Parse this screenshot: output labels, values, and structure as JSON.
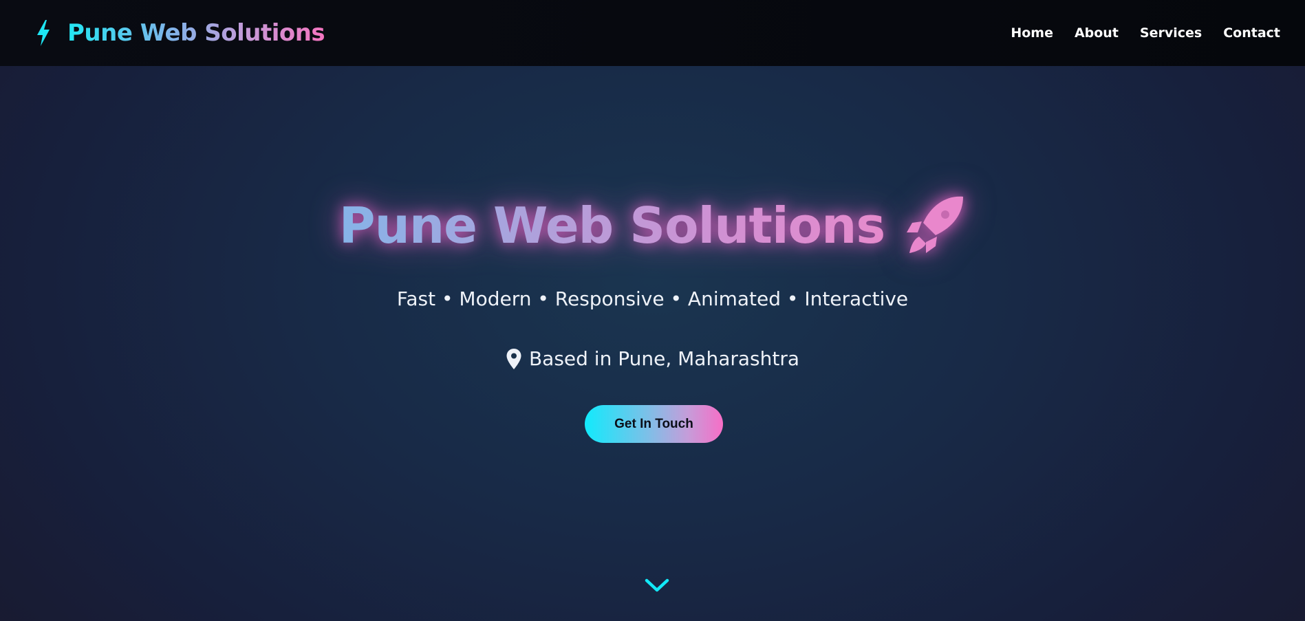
{
  "navbar": {
    "brand_icon": "bolt-icon",
    "brand_name": "Pune Web Solutions",
    "links": [
      "Home",
      "About",
      "Services",
      "Contact"
    ]
  },
  "hero": {
    "title": "Pune Web Solutions",
    "title_icon": "rocket-icon",
    "tagline": "Fast • Modern • Responsive • Animated • Interactive",
    "location_icon": "map-pin-icon",
    "location": "Based in Pune, Maharashtra",
    "cta_label": "Get In Touch",
    "scroll_icon": "chevron-down-icon"
  },
  "colors": {
    "accent_cyan": "#12eafc",
    "accent_pink": "#f66ec6",
    "glow_pink": "#ec64c8",
    "navbar_bg": "#06080d",
    "hero_bg": "#182a47"
  }
}
